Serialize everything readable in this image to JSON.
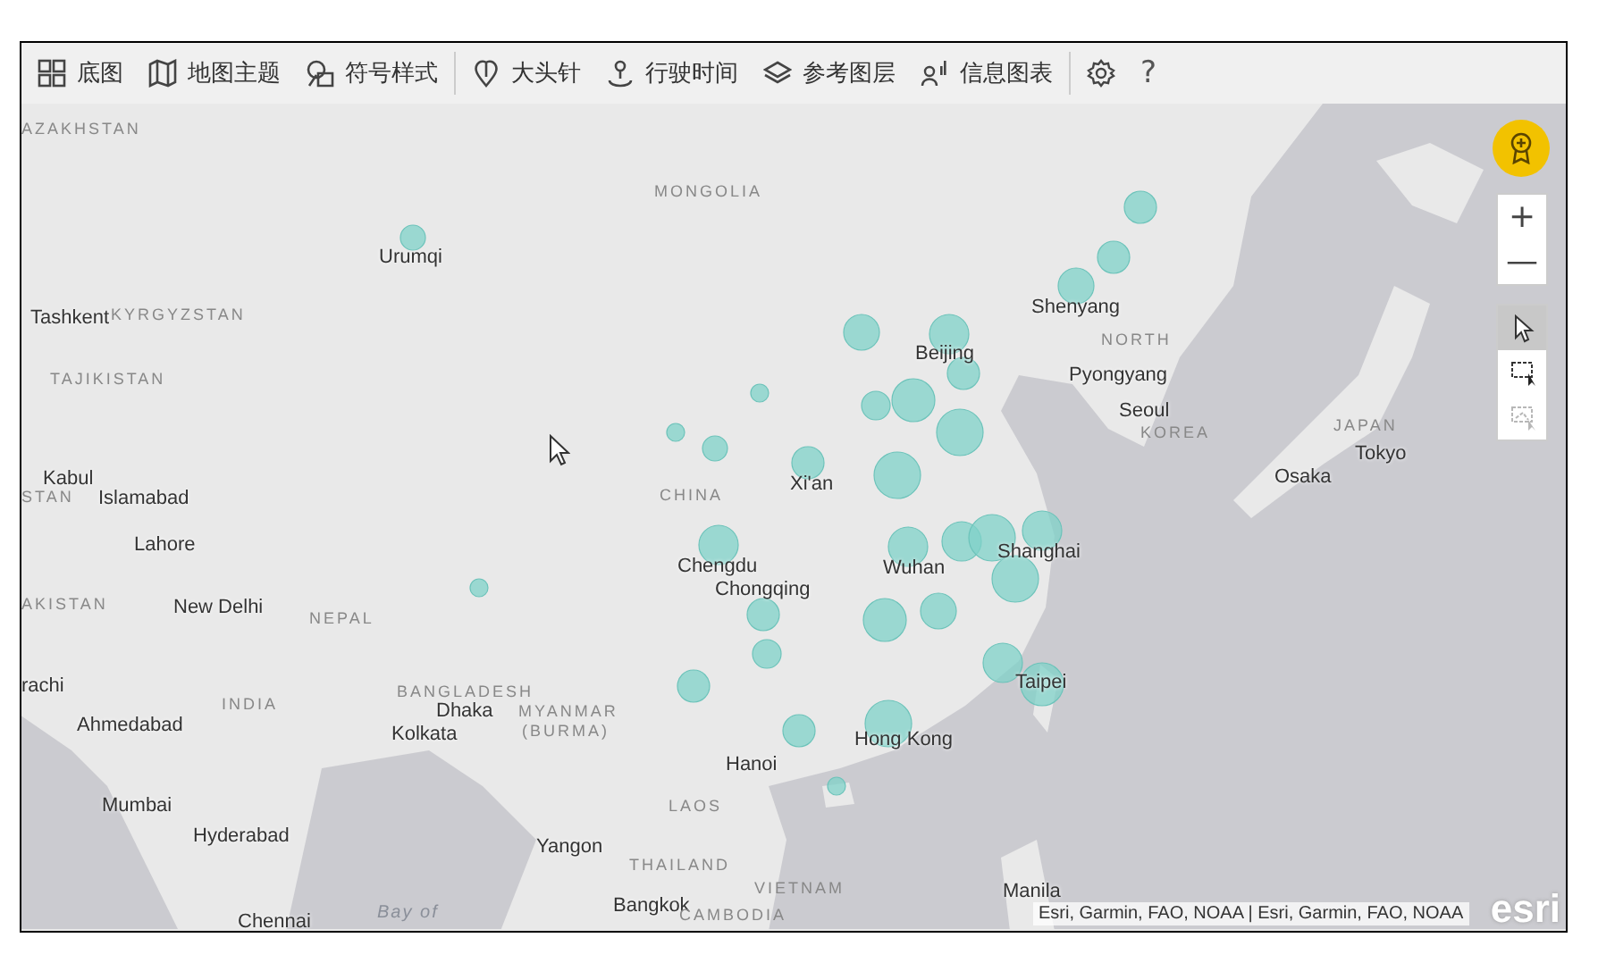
{
  "toolbar": {
    "items": [
      {
        "kind": "basemap",
        "label": "底图"
      },
      {
        "kind": "theme",
        "label": "地图主题"
      },
      {
        "kind": "symbol",
        "label": "符号样式",
        "divider": true
      },
      {
        "kind": "pin",
        "label": "大头针"
      },
      {
        "kind": "drive",
        "label": "行驶时间"
      },
      {
        "kind": "layers",
        "label": "参考图层"
      },
      {
        "kind": "infographic",
        "label": "信息图表",
        "divider": true
      },
      {
        "kind": "settings"
      },
      {
        "kind": "help",
        "label": "?"
      }
    ]
  },
  "map": {
    "labels": [
      {
        "kind": "country",
        "text": "AZAKHSTAN"
      },
      {
        "kind": "country",
        "text": "MONGOLIA"
      },
      {
        "kind": "city",
        "text": "Urumqi"
      },
      {
        "kind": "city",
        "text": "Tashkent"
      },
      {
        "kind": "country",
        "text": "KYRGYZSTAN"
      },
      {
        "kind": "city",
        "text": "Shenyang"
      },
      {
        "kind": "country",
        "text": "NORTH"
      },
      {
        "kind": "city",
        "text": "Beijing"
      },
      {
        "kind": "country",
        "text": "TAJIKISTAN"
      },
      {
        "kind": "city",
        "text": "Pyongyang"
      },
      {
        "kind": "city",
        "text": "Seoul"
      },
      {
        "kind": "country",
        "text": "KOREA"
      },
      {
        "kind": "country",
        "text": "JAPAN"
      },
      {
        "kind": "city",
        "text": "Tokyo"
      },
      {
        "kind": "city",
        "text": "Kabul"
      },
      {
        "kind": "city",
        "text": "Xi'an"
      },
      {
        "kind": "city",
        "text": "Osaka"
      },
      {
        "kind": "country",
        "text": "STAN"
      },
      {
        "kind": "city",
        "text": "Islamabad"
      },
      {
        "kind": "country",
        "text": "CHINA"
      },
      {
        "kind": "city",
        "text": "Lahore"
      },
      {
        "kind": "city",
        "text": "Shanghai"
      },
      {
        "kind": "city",
        "text": "Chengdu"
      },
      {
        "kind": "city",
        "text": "Wuhan"
      },
      {
        "kind": "city",
        "text": "Chongqing"
      },
      {
        "kind": "country",
        "text": "AKISTAN"
      },
      {
        "kind": "city",
        "text": "New Delhi"
      },
      {
        "kind": "country",
        "text": "NEPAL"
      },
      {
        "kind": "city",
        "text": "rachi"
      },
      {
        "kind": "country",
        "text": "BANGLADESH"
      },
      {
        "kind": "city",
        "text": "Taipei"
      },
      {
        "kind": "country",
        "text": "INDIA"
      },
      {
        "kind": "city",
        "text": "Dhaka"
      },
      {
        "kind": "country",
        "text": "MYANMAR"
      },
      {
        "kind": "city",
        "text": "Ahmedabad"
      },
      {
        "kind": "city",
        "text": "Kolkata"
      },
      {
        "kind": "country",
        "text": "(BURMA)"
      },
      {
        "kind": "city",
        "text": "Hong Kong"
      },
      {
        "kind": "city",
        "text": "Hanoi"
      },
      {
        "kind": "city",
        "text": "Mumbai"
      },
      {
        "kind": "country",
        "text": "LAOS"
      },
      {
        "kind": "city",
        "text": "Hyderabad"
      },
      {
        "kind": "city",
        "text": "Yangon"
      },
      {
        "kind": "country",
        "text": "THAILAND"
      },
      {
        "kind": "country",
        "text": "VIETNAM"
      },
      {
        "kind": "city",
        "text": "Manila"
      },
      {
        "kind": "city",
        "text": "Chennai"
      },
      {
        "kind": "water",
        "text": "Bay of"
      },
      {
        "kind": "city",
        "text": "Bangkok"
      },
      {
        "kind": "country",
        "text": "CAMBODIA"
      }
    ],
    "zoom_buttons": [
      {
        "label": "+"
      },
      {
        "label": "—"
      }
    ],
    "select_tools": [
      {
        "kind": "pointer",
        "selected": true,
        "disabled": false
      },
      {
        "kind": "rectangle",
        "selected": false,
        "disabled": false
      },
      {
        "kind": "lasso",
        "selected": false,
        "disabled": true
      }
    ],
    "attribution": "Esri, Garmin, FAO, NOAA | Esri, Garmin, FAO, NOAA",
    "logo": "esri"
  }
}
